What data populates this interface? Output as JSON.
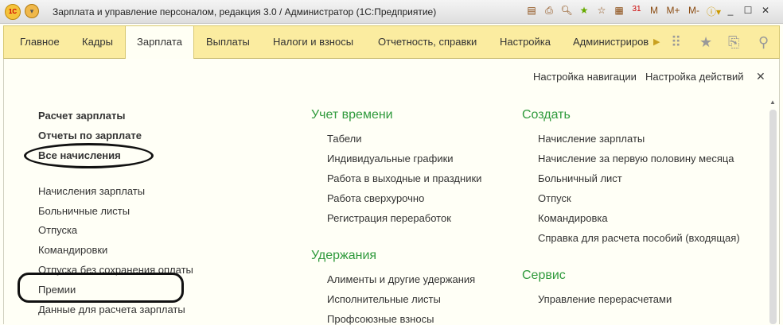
{
  "window": {
    "title": "Зарплата и управление персоналом, редакция 3.0 / Администратор  (1С:Предприятие)",
    "logo": "1С",
    "toolbar_icons": [
      "save-icon",
      "print-icon",
      "preview-icon",
      "add-favorite-icon",
      "favorites-icon",
      "calculator-icon",
      "calendar-icon"
    ],
    "memory_buttons": [
      "M",
      "M+",
      "M-"
    ]
  },
  "tabs": [
    {
      "label": "Главное"
    },
    {
      "label": "Кадры"
    },
    {
      "label": "Зарплата",
      "active": true
    },
    {
      "label": "Выплаты"
    },
    {
      "label": "Налоги и взносы"
    },
    {
      "label": "Отчетность, справки"
    },
    {
      "label": "Настройка"
    },
    {
      "label": "Администриров"
    }
  ],
  "header_links": {
    "nav": "Настройка навигации",
    "actions": "Настройка действий"
  },
  "col1": {
    "bold": [
      "Расчет зарплаты",
      "Отчеты по зарплате",
      "Все начисления"
    ],
    "items": [
      "Начисления зарплаты",
      "Больничные листы",
      "Отпуска",
      "Командировки",
      "Отпуска без сохранения оплаты",
      "Премии",
      "Данные для расчета зарплаты"
    ]
  },
  "col2": {
    "sections": [
      {
        "title": "Учет времени",
        "items": [
          "Табели",
          "Индивидуальные графики",
          "Работа в выходные и праздники",
          "Работа сверхурочно",
          "Регистрация переработок"
        ]
      },
      {
        "title": "Удержания",
        "items": [
          "Алименты и другие удержания",
          "Исполнительные листы",
          "Профсоюзные взносы"
        ]
      }
    ]
  },
  "col3": {
    "sections": [
      {
        "title": "Создать",
        "items": [
          "Начисление зарплаты",
          "Начисление за первую половину месяца",
          "Больничный лист",
          "Отпуск",
          "Командировка",
          "Справка для расчета пособий (входящая)"
        ]
      },
      {
        "title": "Сервис",
        "items": [
          "Управление перерасчетами"
        ]
      }
    ]
  },
  "colors": {
    "tabbar": "#fbeca0",
    "section_title": "#2f9a3c",
    "background": "#fffff6"
  }
}
